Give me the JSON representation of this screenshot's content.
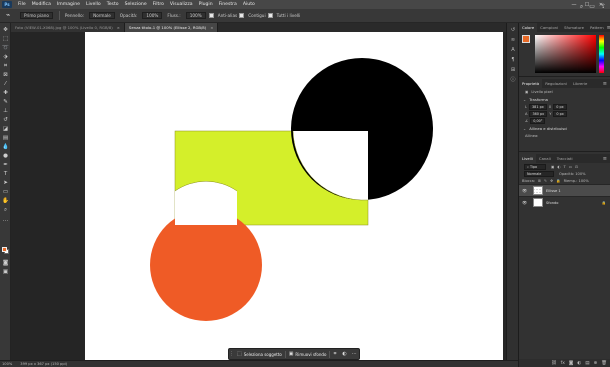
{
  "app": {
    "logo": "Ps"
  },
  "menu": [
    "File",
    "Modifica",
    "Immagine",
    "Livello",
    "Testo",
    "Selezione",
    "Filtro",
    "Visualizza",
    "Plugin",
    "Finestra",
    "Aiuto"
  ],
  "window_controls": {
    "minimize": "—",
    "maximize": "☐",
    "close": "✕"
  },
  "options": {
    "auto_select": "Primo piano",
    "brush_label": "Pennello:",
    "brush_value": "Normale",
    "opacity_label": "Opacità:",
    "opacity_value": "100%",
    "flow_label": "Fluss.:",
    "flow_value": "100%",
    "antialias_label": "Anti-alias",
    "contiguous_label": "Contigui",
    "all_layers_label": "Tutti i livelli"
  },
  "tabs": [
    {
      "label": "Foto (VIEW-01-X068).jpg @ 100% (Livello 0, RGB/8)",
      "active": false
    },
    {
      "label": "Senza titolo-1 @ 100% (Ellisse 2, RGB/8)",
      "active": true
    }
  ],
  "context_bar": {
    "select_subject": "Seleziona soggetto",
    "remove_bg": "Rimuovi sfondo",
    "more": "···"
  },
  "status": {
    "zoom": "100%",
    "doc_info": "399 px x 367 px (150 ppi)"
  },
  "panels": {
    "color_tabs": [
      "Colore",
      "Campioni",
      "Sfumature",
      "Pattern"
    ],
    "props_tabs": [
      "Proprietà",
      "Regolazioni",
      "Librerie"
    ],
    "props_layer_type": "Livello pixel",
    "transform_title": "Trasforma",
    "transform": {
      "w": "381 px",
      "h": "360 px",
      "x": "0 px",
      "y": "0 px",
      "angle": "0,00°"
    },
    "align_title": "Allinea e distribuisci",
    "align_sub": "Allinea:",
    "layers_tabs": [
      "Livelli",
      "Canali",
      "Tracciati"
    ],
    "layers_kind": "Tipo",
    "blend_mode": "Normale",
    "opacity": "Opacità: 100%",
    "lock_label": "Blocca:",
    "fill": "Riemp.: 100%",
    "layers": [
      {
        "name": "Ellisse 1",
        "active": true
      },
      {
        "name": "Sfondo",
        "active": false
      }
    ]
  },
  "colors": {
    "foreground": "#e86a27",
    "background": "#ffffff",
    "yellow": "#d4ef2a",
    "orange": "#ef5b26",
    "black": "#000000"
  }
}
